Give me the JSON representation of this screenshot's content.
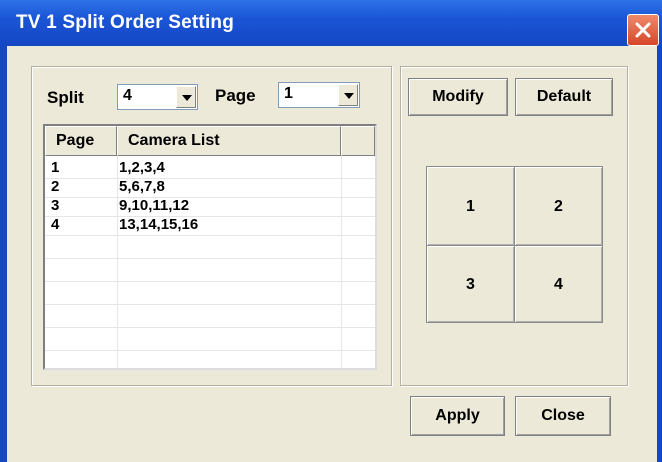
{
  "window": {
    "title": "TV 1 Split Order Setting"
  },
  "split": {
    "label": "Split",
    "value": "4"
  },
  "page": {
    "label": "Page",
    "value": "1"
  },
  "list": {
    "columns": [
      "Page",
      "Camera List"
    ],
    "rows": [
      {
        "page": "1",
        "cameras": "1,2,3,4"
      },
      {
        "page": "2",
        "cameras": "5,6,7,8"
      },
      {
        "page": "3",
        "cameras": "9,10,11,12"
      },
      {
        "page": "4",
        "cameras": "13,14,15,16"
      }
    ]
  },
  "buttons": {
    "modify": "Modify",
    "default": "Default",
    "apply": "Apply",
    "close": "Close"
  },
  "grid": {
    "cells": [
      "1",
      "2",
      "3",
      "4"
    ]
  },
  "colors": {
    "titlebar": "#1a55d6",
    "face": "#ece9d8",
    "close": "#d6452a"
  },
  "icons": {
    "close": "close-icon",
    "dropdown": "dropdown-arrow-icon"
  }
}
